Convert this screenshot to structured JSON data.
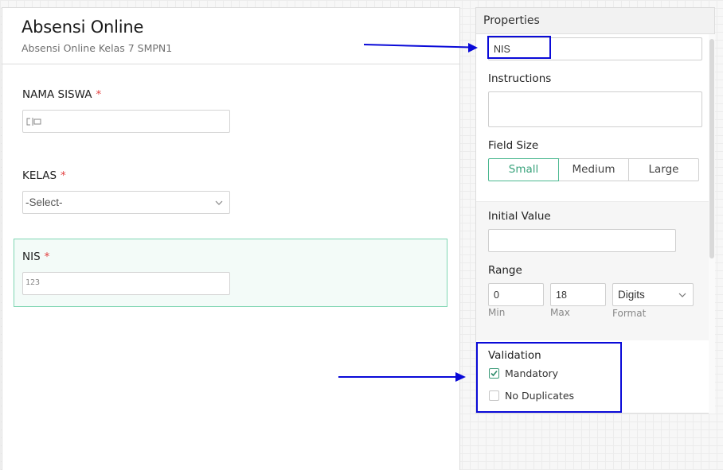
{
  "form": {
    "title": "Absensi Online",
    "subtitle": "Absensi Online Kelas 7 SMPN1",
    "required_marker": "*",
    "fields": [
      {
        "label": "NAMA SISWA",
        "type": "text",
        "icon_text": "☐̲☐"
      },
      {
        "label": "KELAS",
        "type": "select",
        "value": "-Select-"
      },
      {
        "label": "NIS",
        "type": "number",
        "icon_text": "123"
      }
    ]
  },
  "properties": {
    "title": "Properties",
    "field_label_value": "NIS",
    "instructions_label": "Instructions",
    "instructions_value": "",
    "field_size_label": "Field Size",
    "field_size_options": [
      "Small",
      "Medium",
      "Large"
    ],
    "field_size_selected": "Small",
    "initial_value_label": "Initial Value",
    "initial_value": "",
    "range_label": "Range",
    "range_min": "0",
    "range_max": "18",
    "range_format": "Digits",
    "min_caption": "Min",
    "max_caption": "Max",
    "format_caption": "Format",
    "validation_label": "Validation",
    "mandatory_label": "Mandatory",
    "mandatory_checked": true,
    "no_duplicates_label": "No Duplicates",
    "no_duplicates_checked": false
  },
  "colors": {
    "accent_green": "#4cb891",
    "annotation_blue": "#0a0ad8",
    "required_red": "#e23d3d"
  },
  "icons": [
    "chevron-down-icon",
    "checkmark-icon",
    "arrow-right-icon",
    "text-field-icon",
    "number-field-icon"
  ]
}
